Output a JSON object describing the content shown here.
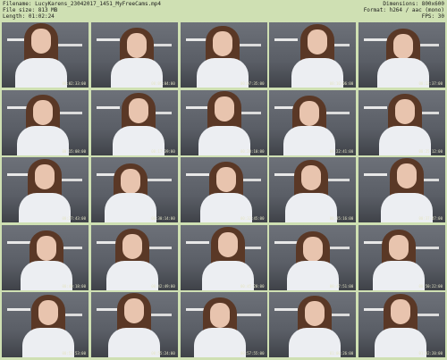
{
  "header": {
    "filename_label": "Filename: LucyKarens_23042017_1451_MyFreeCams.mp4",
    "filesize_label": "File size: 813 MB",
    "length_label": "Length: 01:02:24",
    "dimensions_label": "Dimensions: 800x600",
    "format_label": "Format: h264 / aac (mono)",
    "fps_label": "FPS: 30"
  },
  "thumbnails": [
    {
      "stamp": "00:02:33:00"
    },
    {
      "stamp": "00:05:04:00"
    },
    {
      "stamp": "00:07:35:00"
    },
    {
      "stamp": "00:10:06:00"
    },
    {
      "stamp": "00:12:37:00"
    },
    {
      "stamp": "00:15:08:00"
    },
    {
      "stamp": "00:17:39:00"
    },
    {
      "stamp": "00:20:10:00"
    },
    {
      "stamp": "00:22:41:00"
    },
    {
      "stamp": "00:25:12:00"
    },
    {
      "stamp": "00:27:43:00"
    },
    {
      "stamp": "00:30:14:00"
    },
    {
      "stamp": "00:32:45:00"
    },
    {
      "stamp": "00:35:16:00"
    },
    {
      "stamp": "00:37:47:00"
    },
    {
      "stamp": "00:40:18:00"
    },
    {
      "stamp": "00:42:49:00"
    },
    {
      "stamp": "00:45:20:00"
    },
    {
      "stamp": "00:47:51:00"
    },
    {
      "stamp": "00:50:22:00"
    },
    {
      "stamp": "00:52:53:00"
    },
    {
      "stamp": "00:55:24:00"
    },
    {
      "stamp": "00:57:55:00"
    },
    {
      "stamp": "01:00:26:00"
    },
    {
      "stamp": "01:02:20:00"
    }
  ]
}
